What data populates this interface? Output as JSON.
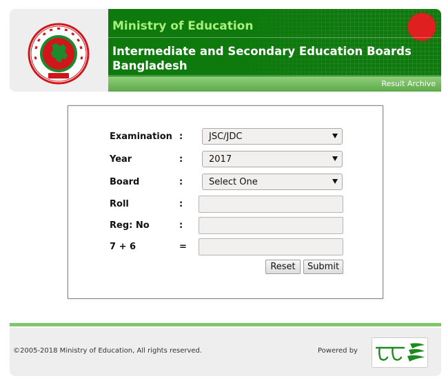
{
  "header": {
    "ministry": "Ministry of Education",
    "boards": "Intermediate and Secondary Education Boards Bangladesh",
    "archive_link": "Result Archive"
  },
  "form": {
    "fields": [
      {
        "label": "Examination",
        "sep": ":",
        "value": "JSC/JDC"
      },
      {
        "label": "Year",
        "sep": ":",
        "value": "2017"
      },
      {
        "label": "Board",
        "sep": ":",
        "value": "Select One"
      },
      {
        "label": "Roll",
        "sep": ":",
        "value": ""
      },
      {
        "label": "Reg: No",
        "sep": ":",
        "value": ""
      },
      {
        "label": "7 + 6",
        "sep": "=",
        "value": ""
      }
    ],
    "reset_label": "Reset",
    "submit_label": "Submit"
  },
  "footer": {
    "copyright": "©2005-2018 Ministry of Education, All rights reserved.",
    "powered_by": "Powered by"
  },
  "colors": {
    "header_green": "#0e7a0d",
    "ministry_text": "#a8f07a",
    "archive_band": "#6fb85a",
    "footer_bg": "#eeeeee",
    "teletalk_green": "#1e8a1e"
  },
  "icons": {
    "logo": "government-seal-icon",
    "flag": "bangladesh-flag-icon",
    "teletalk": "teletalk-logo-icon"
  }
}
